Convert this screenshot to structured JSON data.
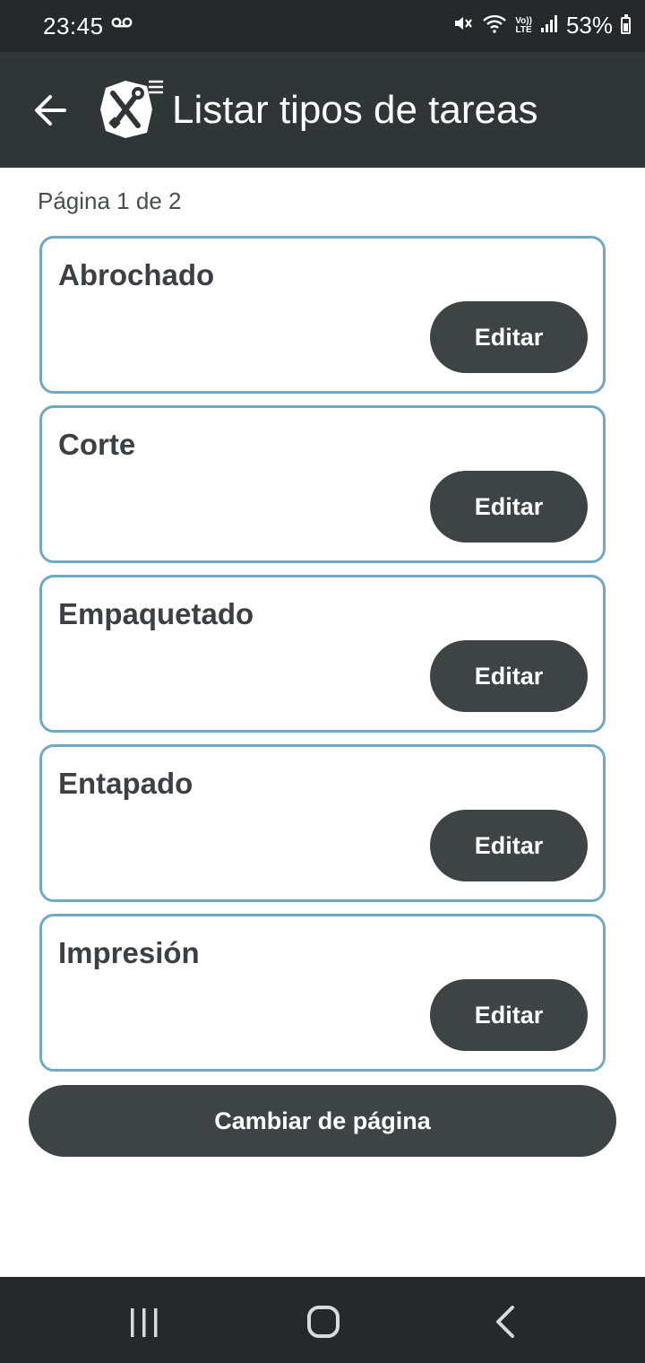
{
  "status_bar": {
    "time": "23:45",
    "volte_top": "Vo))",
    "volte_bottom": "LTE",
    "battery": "53%",
    "icons": [
      "voicemail-icon",
      "mute-icon",
      "wifi-icon",
      "volte-icon",
      "signal-icon",
      "battery-icon"
    ]
  },
  "app_bar": {
    "title": "Listar tipos de tareas",
    "back_icon": "arrow-left-icon",
    "logo_icon": "tools-list-icon"
  },
  "page_indicator": "Página 1 de 2",
  "tasks": [
    {
      "name": "Abrochado",
      "action": "Editar"
    },
    {
      "name": "Corte",
      "action": "Editar"
    },
    {
      "name": "Empaquetado",
      "action": "Editar"
    },
    {
      "name": "Entapado",
      "action": "Editar"
    },
    {
      "name": "Impresión",
      "action": "Editar"
    }
  ],
  "change_page_label": "Cambiar de página",
  "nav_bar": {
    "icons": [
      "recents-icon",
      "home-icon",
      "back-icon"
    ]
  },
  "colors": {
    "status_bar_bg": "#25292c",
    "app_bar_bg": "#303538",
    "card_border": "#6fa9c6",
    "button_bg": "#3e4346",
    "task_text": "#3e3f45"
  }
}
